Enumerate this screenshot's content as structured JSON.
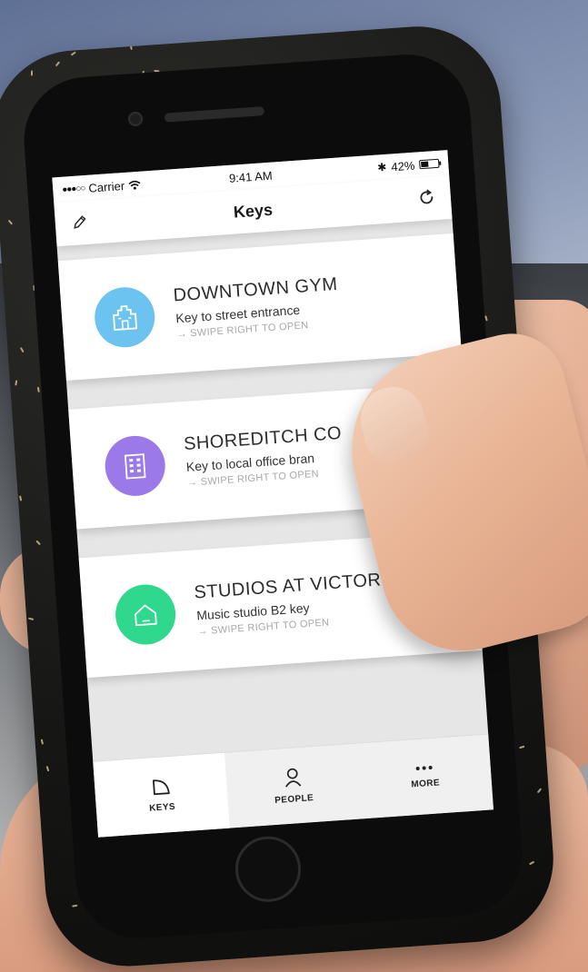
{
  "status_bar": {
    "carrier": "Carrier",
    "time": "9:41 AM",
    "battery": "42%",
    "battery_level": 0.42
  },
  "nav": {
    "title": "Keys"
  },
  "keys": [
    {
      "title": "DOWNTOWN GYM",
      "subtitle": "Key to street entrance",
      "hint": "SWIPE RIGHT TO OPEN",
      "icon": "building-icon",
      "color": "#6cc3f0"
    },
    {
      "title": "SHOREDITCH CO",
      "subtitle": "Key to local office bran",
      "hint": "SWIPE RIGHT TO OPEN",
      "icon": "office-icon",
      "color": "#9b79e8"
    },
    {
      "title": "STUDIOS AT VICTORIA",
      "subtitle": "Music studio B2 key",
      "hint": "SWIPE RIGHT TO OPEN",
      "icon": "house-icon",
      "color": "#2fd88c"
    }
  ],
  "tabs": [
    {
      "label": "KEYS",
      "icon": "key-tab-icon",
      "active": true
    },
    {
      "label": "PEOPLE",
      "icon": "person-icon",
      "active": false
    },
    {
      "label": "MORE",
      "icon": "more-dots-icon",
      "active": false
    }
  ]
}
